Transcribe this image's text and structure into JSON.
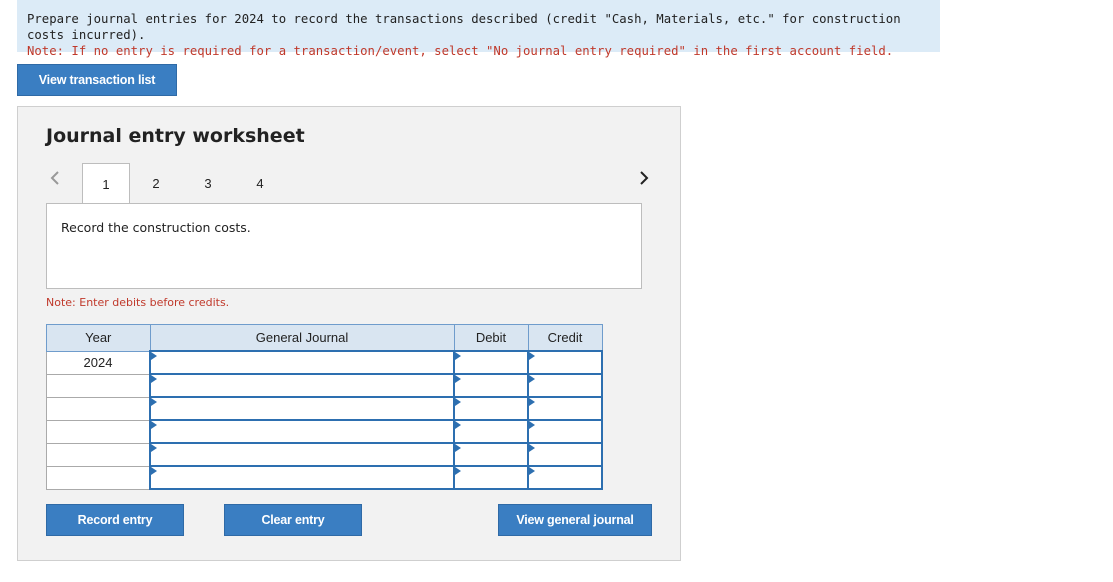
{
  "instructions": {
    "main": "Prepare journal entries for 2024 to record the transactions described (credit \"Cash, Materials, etc.\" for construction costs incurred).",
    "note": "Note: If no entry is required for a transaction/event, select \"No journal entry required\" in the first account field."
  },
  "buttons": {
    "view_transactions": "View transaction list",
    "record_entry": "Record entry",
    "clear_entry": "Clear entry",
    "view_general_journal": "View general journal"
  },
  "worksheet": {
    "title": "Journal entry worksheet",
    "tabs": [
      "1",
      "2",
      "3",
      "4"
    ],
    "active_tab": "1",
    "description": "Record the construction costs.",
    "note": "Note: Enter debits before credits."
  },
  "journal": {
    "headers": {
      "year": "Year",
      "account": "General Journal",
      "debit": "Debit",
      "credit": "Credit"
    },
    "rows": [
      {
        "year": "2024",
        "account": "",
        "debit": "",
        "credit": ""
      },
      {
        "year": "",
        "account": "",
        "debit": "",
        "credit": ""
      },
      {
        "year": "",
        "account": "",
        "debit": "",
        "credit": ""
      },
      {
        "year": "",
        "account": "",
        "debit": "",
        "credit": ""
      },
      {
        "year": "",
        "account": "",
        "debit": "",
        "credit": ""
      },
      {
        "year": "",
        "account": "",
        "debit": "",
        "credit": ""
      }
    ]
  },
  "colors": {
    "accent": "#3a7ec2",
    "panel": "#f2f2f2",
    "note": "#c0392b",
    "banner": "#dcebf7"
  }
}
